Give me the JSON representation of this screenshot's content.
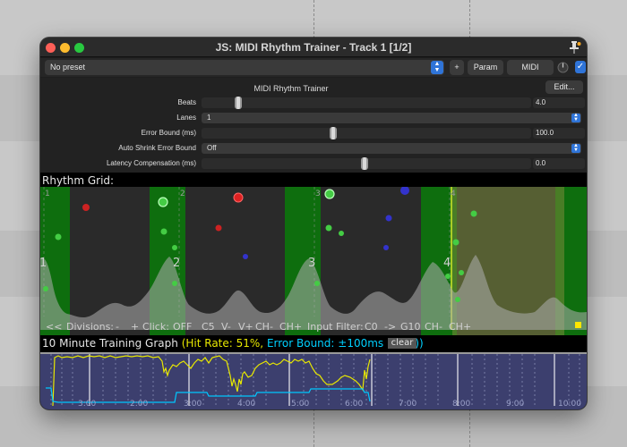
{
  "window": {
    "title": "JS: MIDI Rhythm Trainer - Track 1 [1/2]"
  },
  "toolbar": {
    "preset": "No preset",
    "add_label": "+",
    "param_label": "Param",
    "midi_label": "MIDI",
    "check": "✓"
  },
  "plugin": {
    "name": "MIDI Rhythm Trainer",
    "edit_label": "Edit...",
    "params": {
      "beats": {
        "label": "Beats",
        "value": "4.0",
        "level": 0.09
      },
      "lanes": {
        "label": "Lanes",
        "value": "1"
      },
      "error_bound": {
        "label": "Error Bound (ms)",
        "value": "100.0",
        "level": 0.4
      },
      "auto_shrink": {
        "label": "Auto Shrink Error Bound",
        "value": "Off"
      },
      "latency": {
        "label": "Latency Compensation (ms)",
        "value": "0.0",
        "level": 0.5
      }
    }
  },
  "rhythm_grid": {
    "label": "Rhythm Grid:",
    "beat_numbers": [
      "1",
      "2",
      "3",
      "4"
    ],
    "division_labels": [
      "1",
      "2",
      "3",
      "4"
    ],
    "controls": [
      "<<",
      "Divisions:",
      "-",
      "+",
      "Click:",
      "OFF",
      "C5",
      "V-",
      "V+",
      "CH-",
      "CH+",
      "Input Filter:",
      "C0",
      "->",
      "G10",
      "CH-",
      "CH+"
    ]
  },
  "training_graph": {
    "title": "10 Minute Training Graph",
    "hit_rate_text": "(Hit Rate: 51%,",
    "error_bound_text": "Error Bound: ±100ms (40%))",
    "clear_label": "clear",
    "x_ticks": [
      "3:00",
      "2:00",
      "3:00",
      "4:00",
      "5:00",
      "6:00",
      "7:00",
      "8:00",
      "9:00",
      "10:00"
    ]
  },
  "colors": {
    "beat_green": "#0e6e0e",
    "yellow_text": "#e8e800",
    "cyan_text": "#00d0ff",
    "accent_blue": "#2f74d8"
  }
}
